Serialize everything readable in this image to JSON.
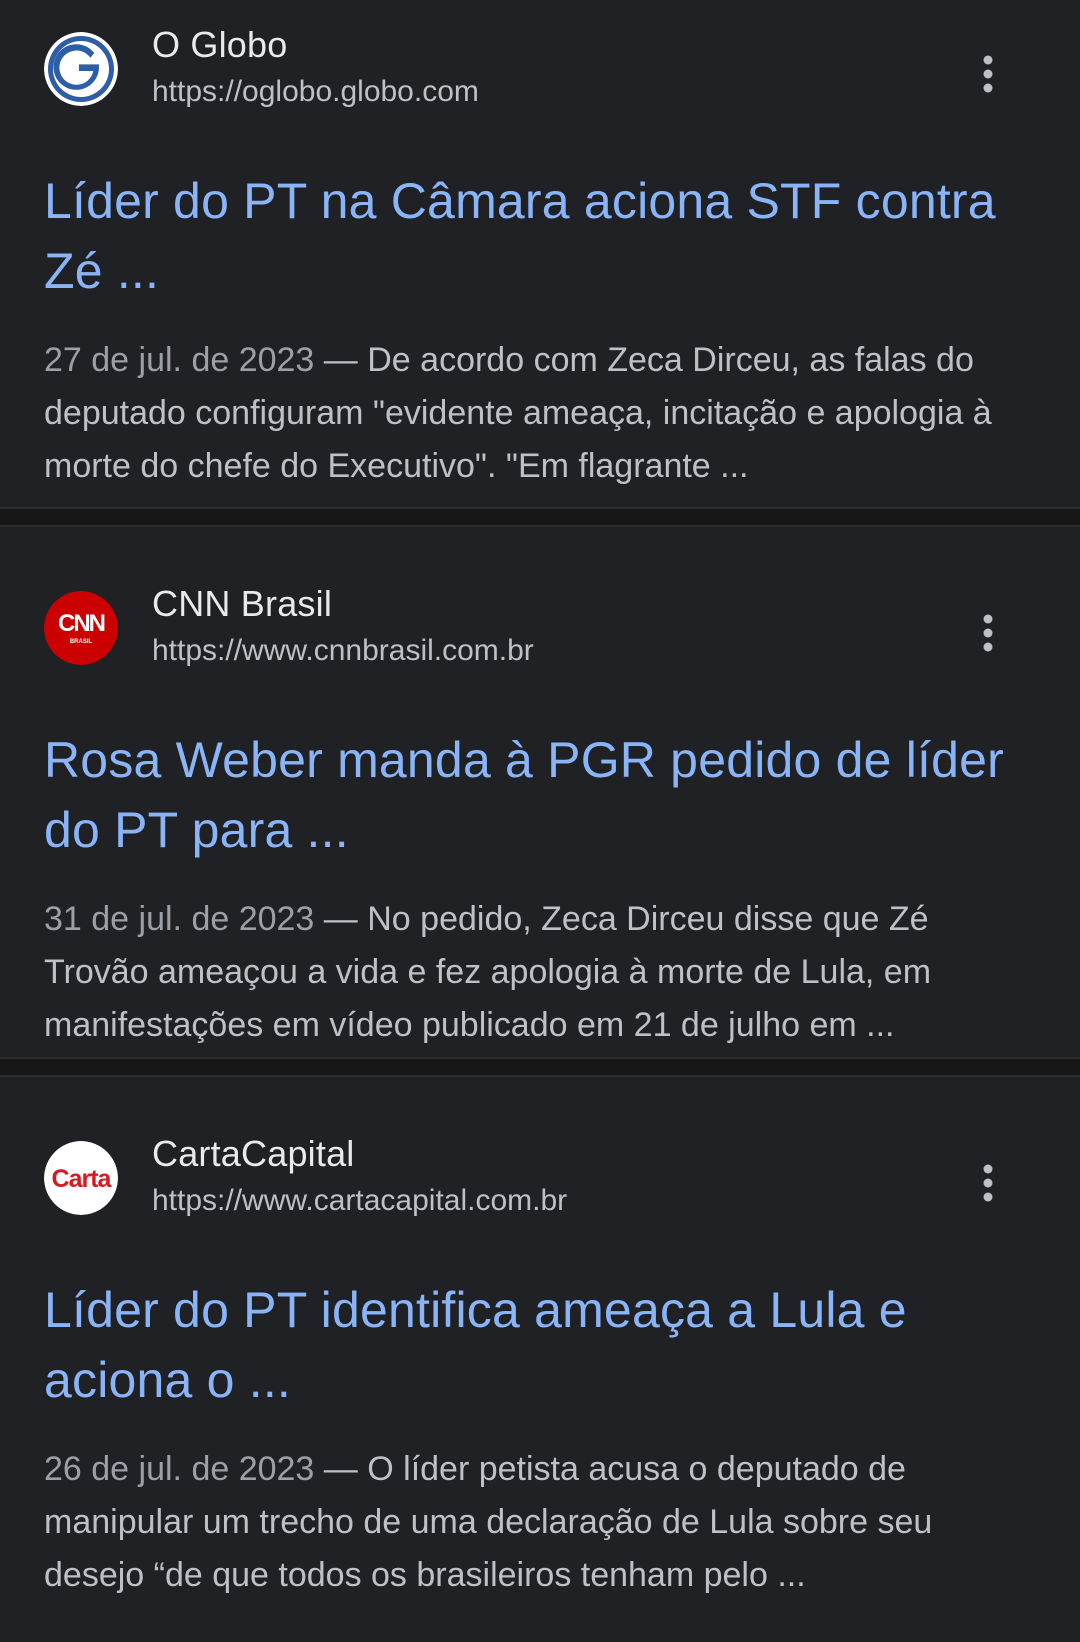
{
  "results": [
    {
      "source_name": "O Globo",
      "source_url": "https://oglobo.globo.com",
      "favicon_icon": "o-globo-logo-icon",
      "title": "Líder do PT na Câmara aciona STF contra Zé ...",
      "date": "27 de jul. de 2023",
      "separator": " — ",
      "snippet": "De acordo com Zeca Dirceu, as falas do deputado configuram \"evidente ameaça, incitação e apologia à morte do chefe do Executivo\". \"Em flagrante ..."
    },
    {
      "source_name": "CNN Brasil",
      "source_url": "https://www.cnnbrasil.com.br",
      "favicon_icon": "cnn-brasil-logo-icon",
      "title": "Rosa Weber manda à PGR pedido de líder do PT para ...",
      "date": "31 de jul. de 2023",
      "separator": " — ",
      "snippet": "No pedido, Zeca Dirceu disse que Zé Trovão ameaçou a vida e fez apologia à morte de Lula, em manifestações em vídeo publicado em 21 de julho em ..."
    },
    {
      "source_name": "CartaCapital",
      "source_url": "https://www.cartacapital.com.br",
      "favicon_icon": "cartacapital-logo-icon",
      "favicon_text": "Carta",
      "title": "Líder do PT identifica ameaça a Lula e aciona o ...",
      "date": "26 de jul. de 2023",
      "separator": " — ",
      "snippet": "O líder petista acusa o deputado de manipular um trecho de uma declaração de Lula sobre seu desejo “de que todos os brasileiros tenham pelo ..."
    }
  ],
  "colors": {
    "background": "#202124",
    "title_link": "#8ab4f8",
    "source_name": "#e8eaed",
    "secondary_text": "#bdc1c6",
    "date_text": "#9aa0a6",
    "separator_band": "#171717"
  }
}
